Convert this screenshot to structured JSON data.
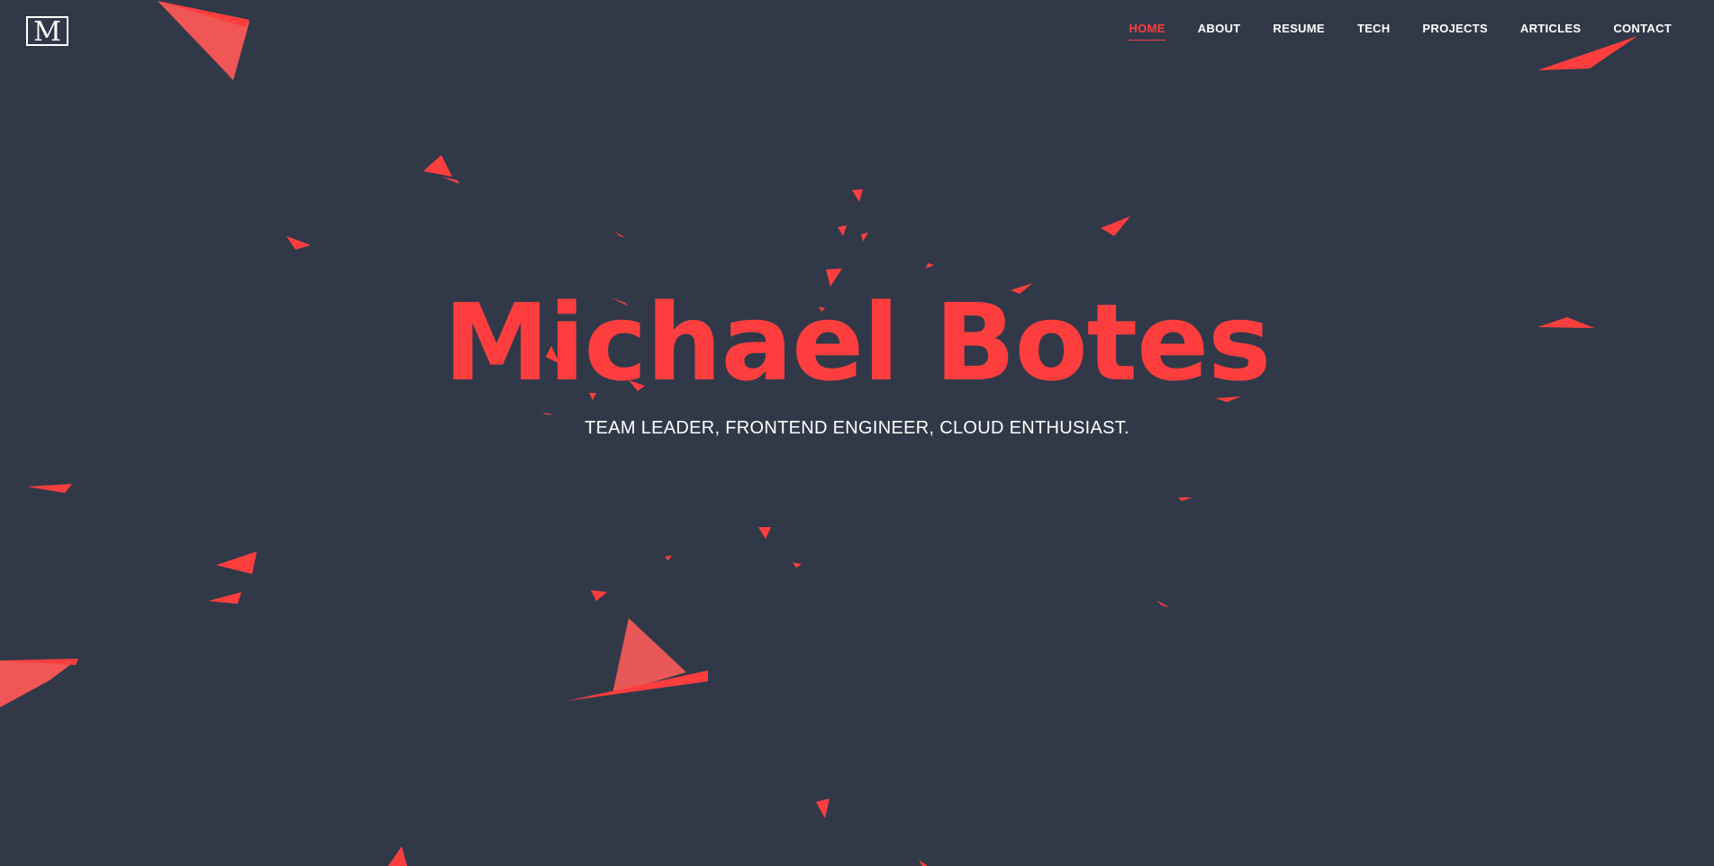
{
  "brand": {
    "logo_text": "M"
  },
  "nav": {
    "items": [
      {
        "label": "HOME",
        "active": true
      },
      {
        "label": "ABOUT",
        "active": false
      },
      {
        "label": "RESUME",
        "active": false
      },
      {
        "label": "TECH",
        "active": false
      },
      {
        "label": "PROJECTS",
        "active": false
      },
      {
        "label": "ARTICLES",
        "active": false
      },
      {
        "label": "CONTACT",
        "active": false
      }
    ]
  },
  "hero": {
    "title": "Michael Botes",
    "subtitle": "TEAM LEADER, FRONTEND ENGINEER, CLOUD ENTHUSIAST."
  },
  "colors": {
    "background": "#313949",
    "accent": "#fe3e3e",
    "text": "#ffffff"
  }
}
